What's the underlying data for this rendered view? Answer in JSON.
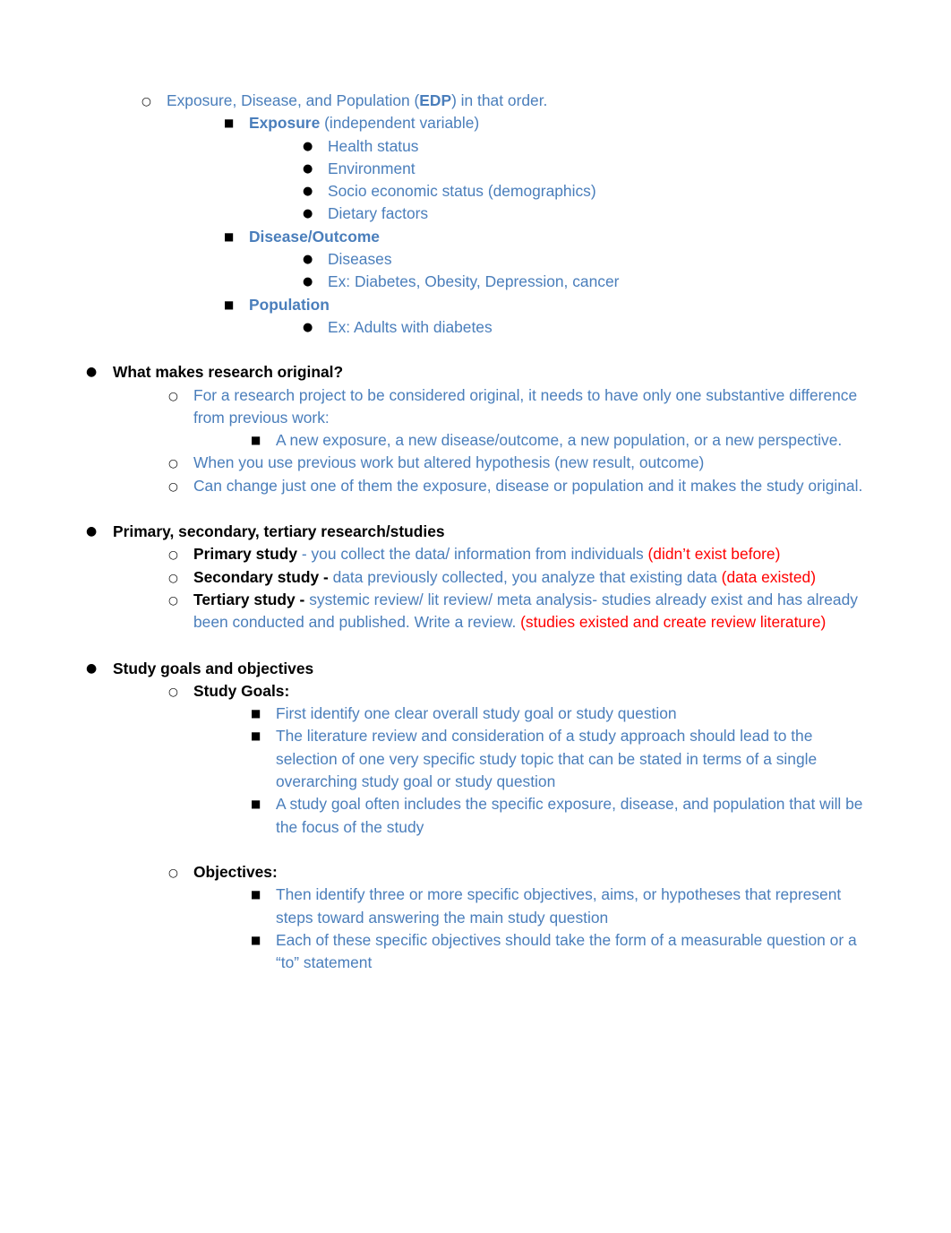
{
  "document": {
    "bullets": {
      "disc": "●",
      "circle": "○",
      "square": "■"
    },
    "colors": {
      "blue": "#4a7ebb",
      "red": "#ff0000",
      "black": "#000000"
    },
    "edp": {
      "lead_text": "Exposure, Disease, and Population (",
      "acronym": "EDP",
      "tail_text": ") in that order.",
      "exposure": {
        "label": "Exposure",
        "suffix": " (independent variable)",
        "items": [
          "Health status",
          "Environment",
          "Socio economic status (demographics)",
          "Dietary factors"
        ]
      },
      "disease": {
        "label": "Disease/Outcome",
        "items": [
          "Diseases",
          "Ex: Diabetes, Obesity, Depression, cancer"
        ]
      },
      "population": {
        "label": "Population",
        "items": [
          "Ex: Adults with diabetes"
        ]
      }
    },
    "originality": {
      "heading": "What makes research original?",
      "point1": "For a research project to be considered original, it needs to have only one substantive difference from previous work:",
      "point1_sub": "A new exposure, a new disease/outcome, a new population, or a new perspective.",
      "point2": "When you use previous work but altered hypothesis (new result, outcome)",
      "point3": "Can change just one of them the exposure, disease or population and it makes the study original."
    },
    "research_types": {
      "heading": "Primary, secondary, tertiary research/studies",
      "primary": {
        "label": "Primary study",
        "dash": " - ",
        "blue_text": "you collect the data/ information from individuals ",
        "red_text": "(didn’t exist before)"
      },
      "secondary": {
        "label": "Secondary study - ",
        "blue_text": "data previously collected, you analyze that existing data ",
        "red_text": "(data existed)"
      },
      "tertiary": {
        "label": "Tertiary study - ",
        "blue_text": "systemic review/ lit review/ meta analysis- studies already exist and has already been conducted and published. Write a review. ",
        "red_text": "(studies existed and create review literature)"
      }
    },
    "study_goals": {
      "heading": "Study goals and objectives",
      "goals_label": "Study Goals:",
      "goals_items": [
        "First identify one clear overall study goal or study question",
        "The literature review and consideration of a study approach should lead to the selection of one very specific study topic that can be stated in terms of a single overarching study goal or study question",
        "A study goal often includes the specific exposure, disease, and population that will be the focus of the study"
      ],
      "objectives_label": "Objectives:",
      "objectives_items": [
        "Then identify three or more specific objectives, aims, or hypotheses that represent steps toward answering the main study question",
        "Each of these specific objectives should take the form of a measurable question or a “to” statement"
      ]
    }
  }
}
